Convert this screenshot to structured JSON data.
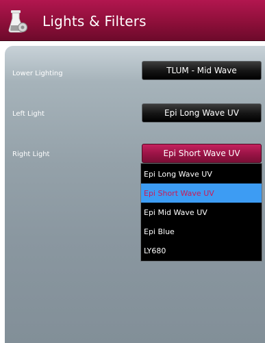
{
  "header": {
    "title": "Lights & Filters",
    "icon": "settings-flask-icon"
  },
  "colors": {
    "brand": "#8e0f3a",
    "selected_item_bg": "#3d9cf3",
    "selected_item_text": "#cc1a55"
  },
  "rows": [
    {
      "label": "Lower Lighting",
      "value": "TLUM - Mid Wave"
    },
    {
      "label": "Left Light",
      "value": "Epi Long Wave UV"
    },
    {
      "label": "Right Light",
      "value": "Epi Short Wave UV"
    }
  ],
  "dropdown": {
    "options": [
      "Epi Long Wave UV",
      "Epi Short Wave UV",
      "Epi Mid Wave UV",
      "Epi Blue",
      "LY680"
    ],
    "selected": "Epi Short Wave UV"
  }
}
